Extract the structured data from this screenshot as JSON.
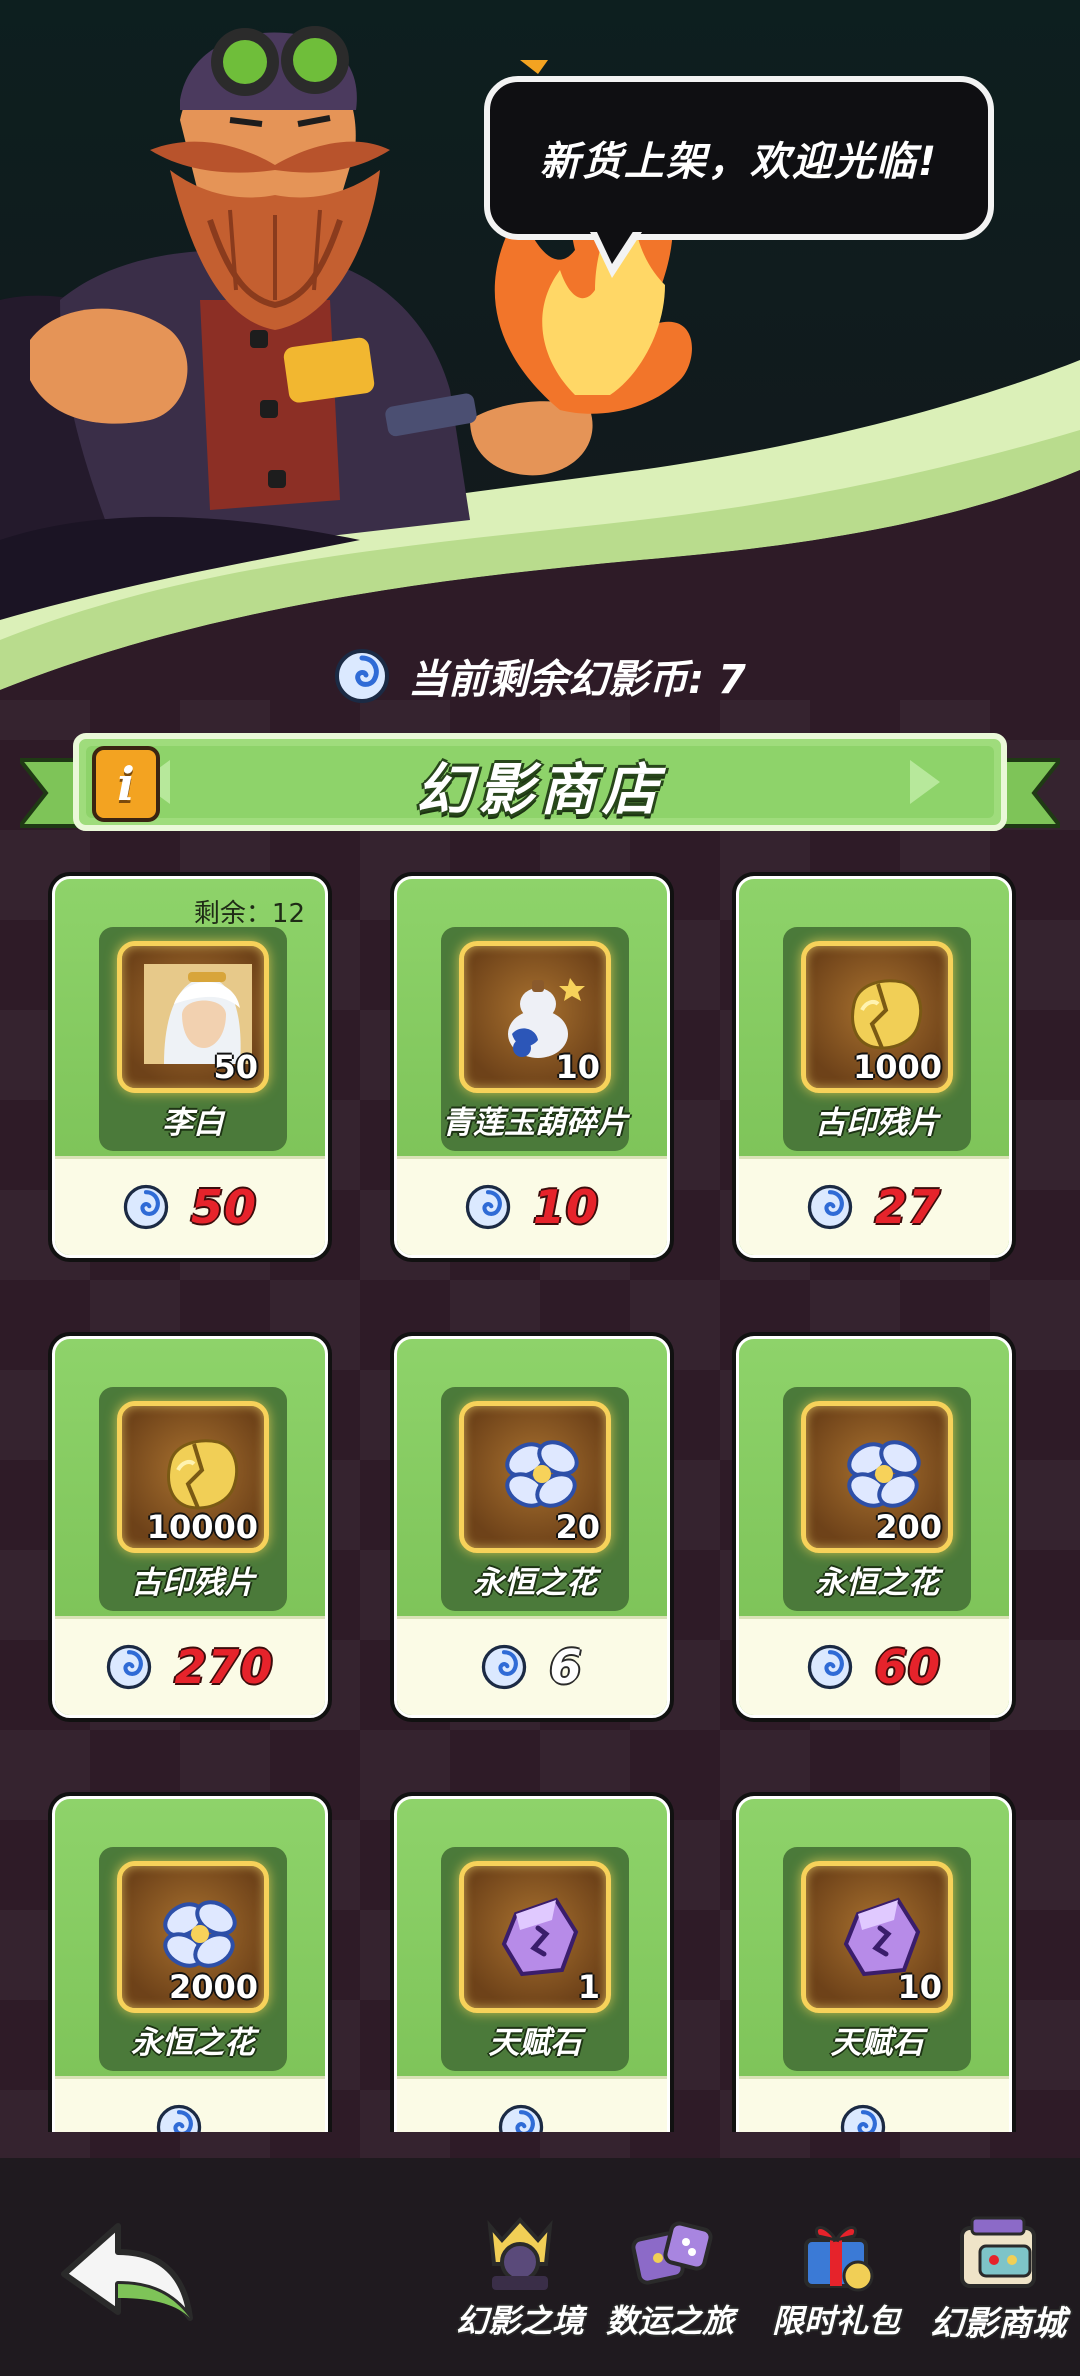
{
  "hero": {
    "speech": "新货上架，欢迎光临!"
  },
  "coins": {
    "status_text": "当前剩余幻影币: 7"
  },
  "shop": {
    "title": "幻影商店",
    "info_label": "i",
    "items": [
      {
        "name": "李白",
        "count": "50",
        "price": "50",
        "remain": "剩余：12",
        "icon": "hero-portrait-icon",
        "price_color": "red"
      },
      {
        "name": "青莲玉葫碎片",
        "count": "10",
        "price": "10",
        "remain": "",
        "icon": "gourd-fragment-icon",
        "price_color": "red"
      },
      {
        "name": "古印残片",
        "count": "1000",
        "price": "27",
        "remain": "",
        "icon": "seal-fragment-icon",
        "price_color": "red"
      },
      {
        "name": "古印残片",
        "count": "10000",
        "price": "270",
        "remain": "",
        "icon": "seal-fragment-icon",
        "price_color": "red"
      },
      {
        "name": "永恒之花",
        "count": "20",
        "price": "6",
        "remain": "",
        "icon": "eternal-flower-icon",
        "price_color": "white"
      },
      {
        "name": "永恒之花",
        "count": "200",
        "price": "60",
        "remain": "",
        "icon": "eternal-flower-icon",
        "price_color": "red"
      },
      {
        "name": "永恒之花",
        "count": "2000",
        "price": "",
        "remain": "",
        "icon": "eternal-flower-icon",
        "price_color": "red"
      },
      {
        "name": "天赋石",
        "count": "1",
        "price": "",
        "remain": "",
        "icon": "talent-stone-icon",
        "price_color": "white"
      },
      {
        "name": "天赋石",
        "count": "10",
        "price": "",
        "remain": "",
        "icon": "talent-stone-icon",
        "price_color": "red"
      }
    ]
  },
  "nav": {
    "items": [
      {
        "label": "幻影之境",
        "icon": "phantom-realm-icon"
      },
      {
        "label": "数运之旅",
        "icon": "dice-journey-icon"
      },
      {
        "label": "限时礼包",
        "icon": "gift-pack-icon"
      },
      {
        "label": "幻影商城",
        "icon": "phantom-mall-icon"
      }
    ]
  },
  "colors": {
    "accent_green": "#8ed36a",
    "price_red": "#e6232b",
    "background": "#2e1b27"
  }
}
